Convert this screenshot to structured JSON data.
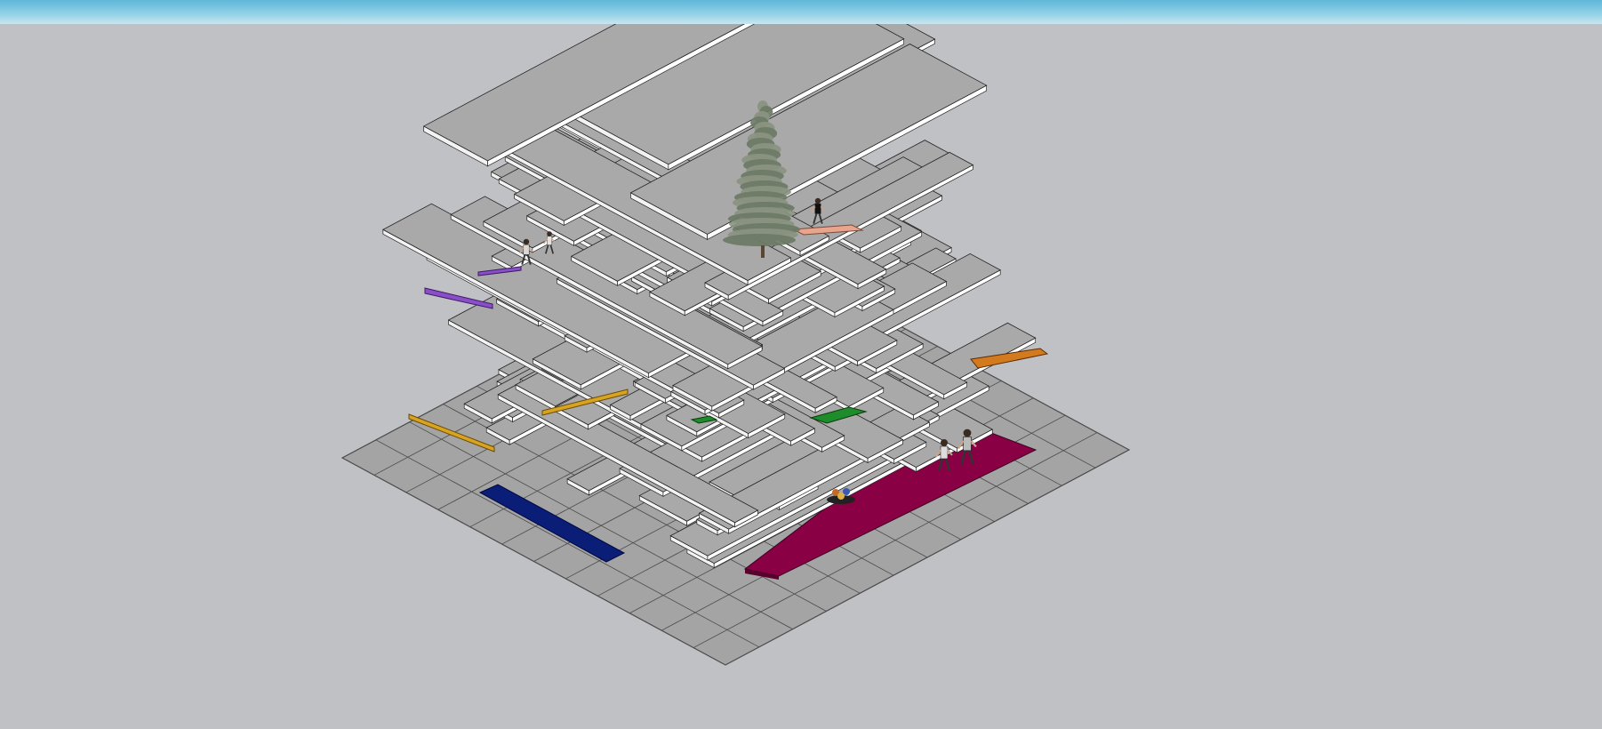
{
  "scene": {
    "sky_color": "#6cc2df",
    "background_color": "#c0c1c5",
    "slab_color": "#a9a9a9",
    "slab_edge_color": "#ffffff",
    "ground_color": "#a4a4a4",
    "grid_line_color": "#4a4a4a"
  },
  "model": {
    "elements": [
      "ground-grid",
      "stacked-slabs",
      "conifer-tree",
      "magenta-floor-slab",
      "navy-floor-slab",
      "orange-slab",
      "purple-slab",
      "amber-slab",
      "green-slab",
      "peach-roof-pad",
      "running-people",
      "sitting-people",
      "standing-people"
    ],
    "accent_colors": {
      "magenta": "#8a0044",
      "navy": "#0a1e78",
      "orange": "#d47a1e",
      "purple": "#8a4ec8",
      "amber": "#d9a322",
      "green": "#1e8c2a",
      "peach": "#e8a48c"
    }
  }
}
